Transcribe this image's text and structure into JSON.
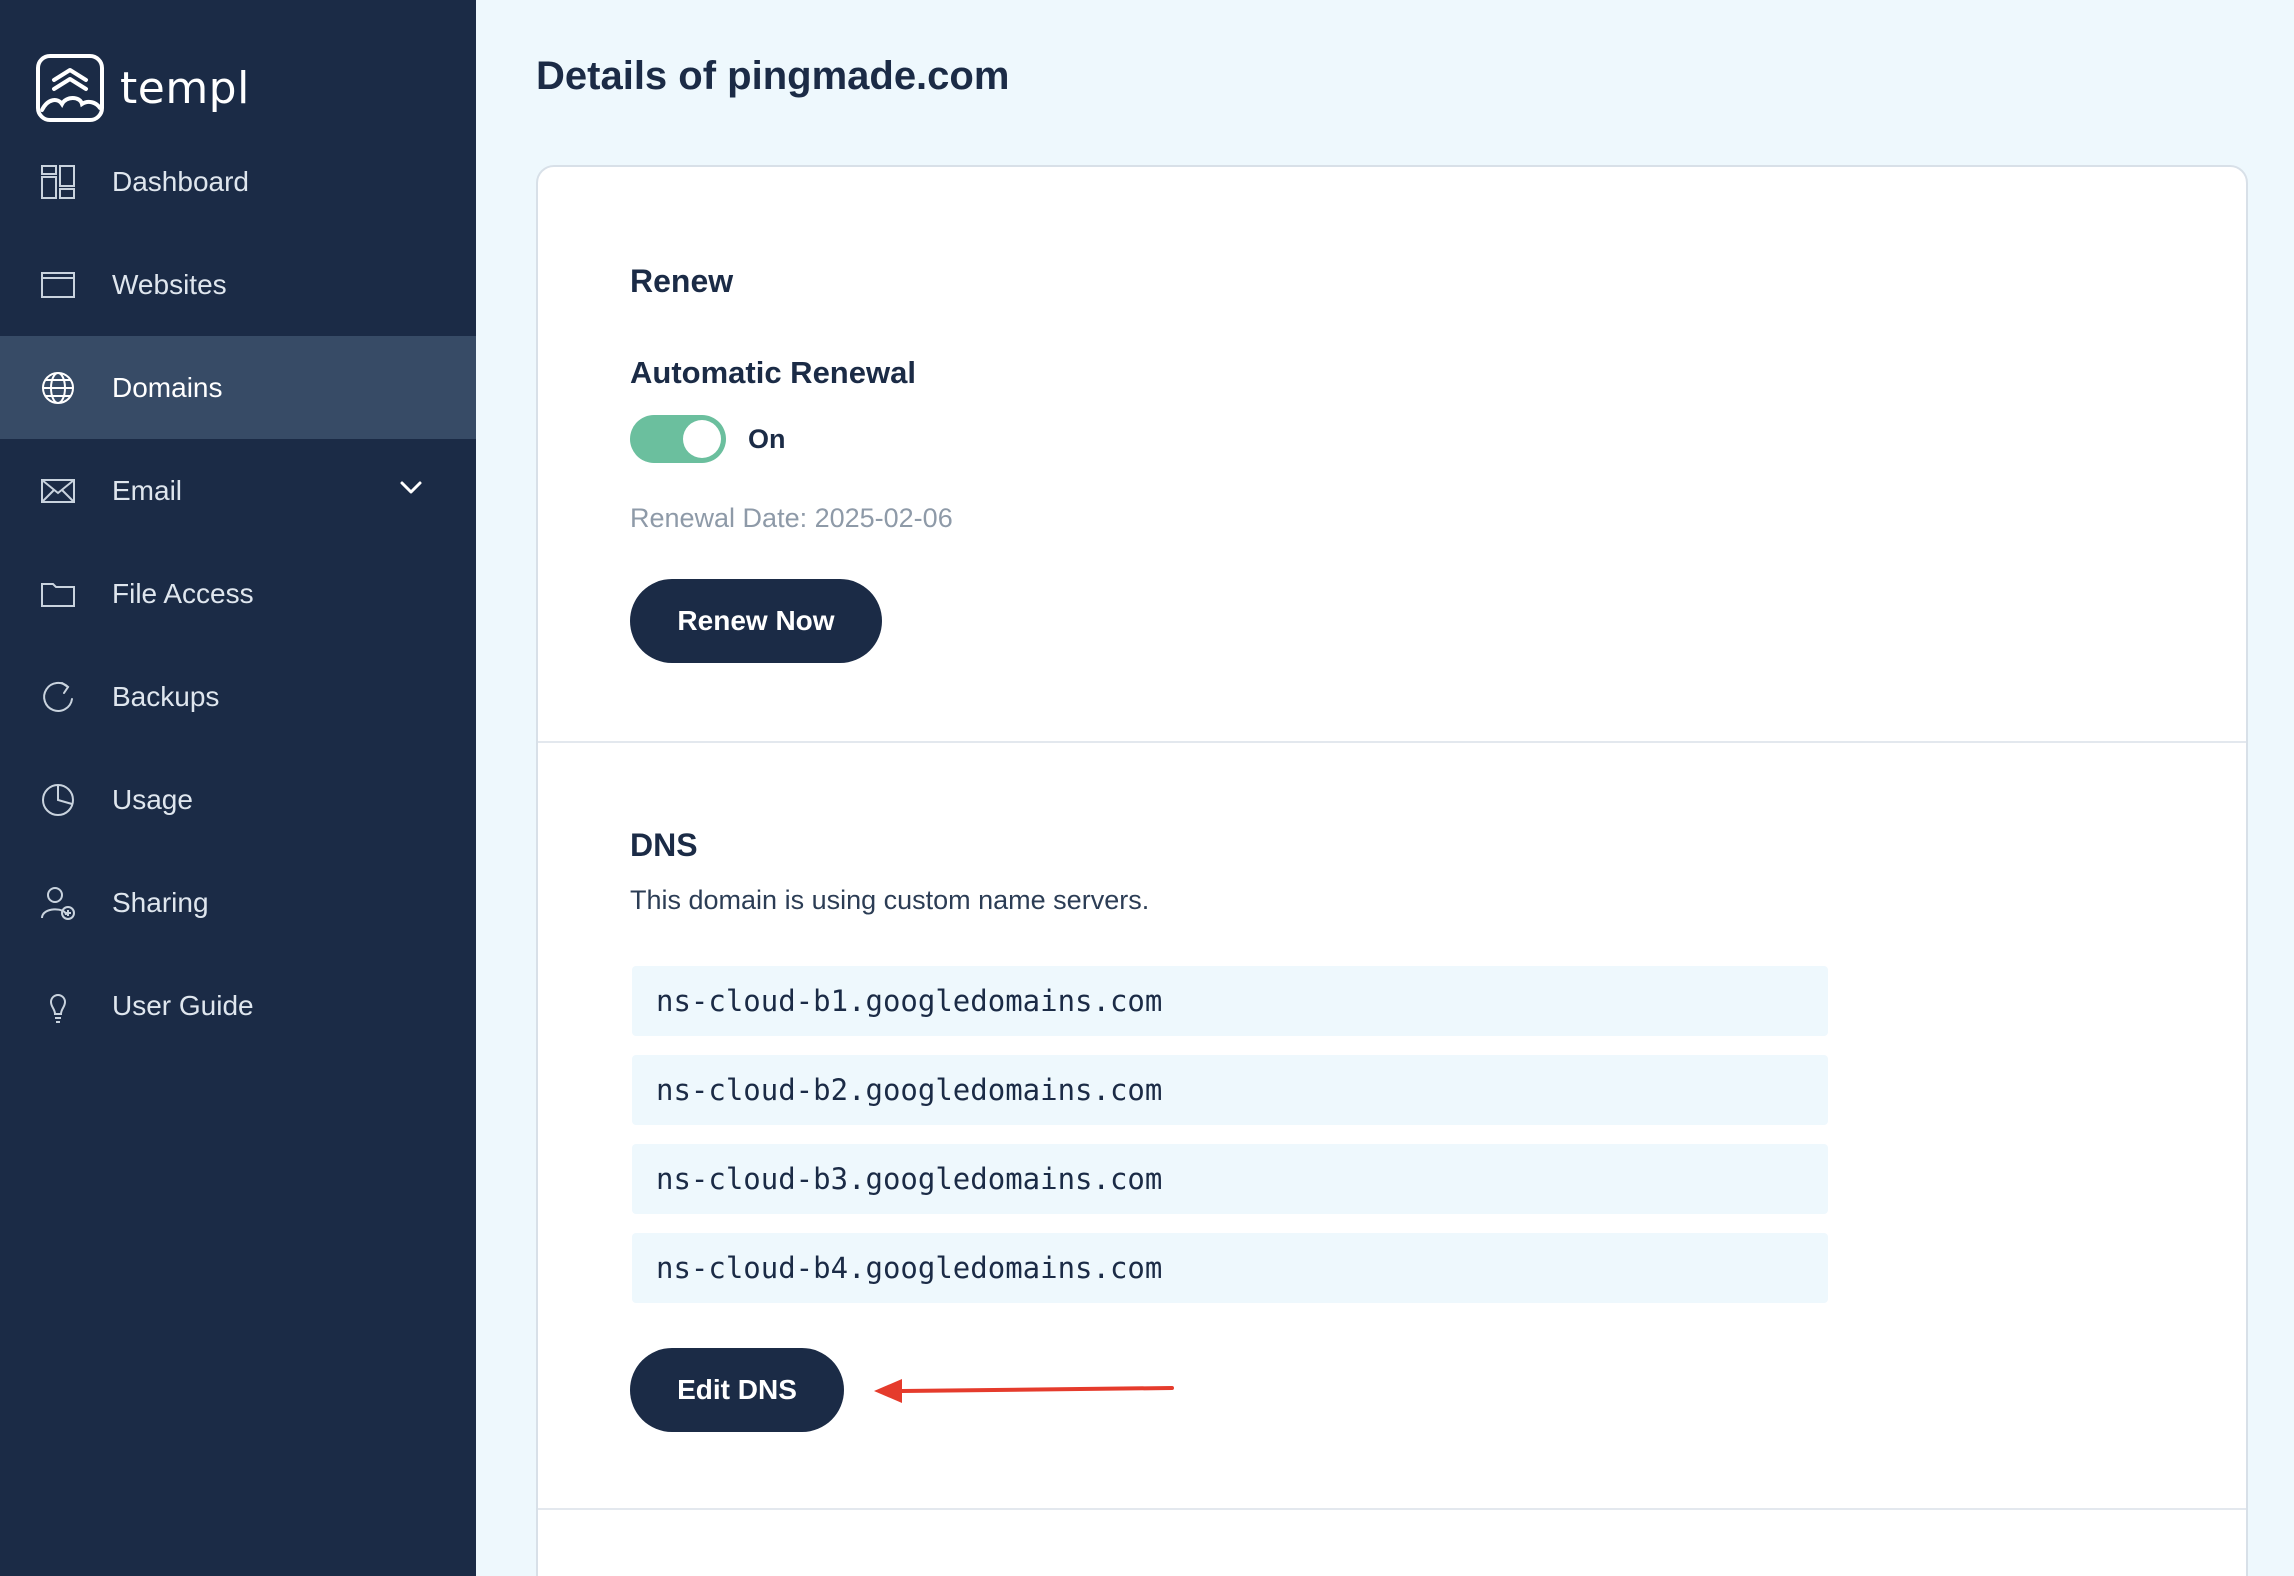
{
  "brand": {
    "name": "templ"
  },
  "sidebar": {
    "items": [
      {
        "label": "Dashboard",
        "icon": "dashboard-icon"
      },
      {
        "label": "Websites",
        "icon": "browser-window-icon"
      },
      {
        "label": "Domains",
        "icon": "globe-icon",
        "active": true
      },
      {
        "label": "Email",
        "icon": "envelope-icon",
        "has_submenu": true
      },
      {
        "label": "File Access",
        "icon": "folder-icon"
      },
      {
        "label": "Backups",
        "icon": "refresh-icon"
      },
      {
        "label": "Usage",
        "icon": "pie-chart-icon"
      },
      {
        "label": "Sharing",
        "icon": "user-add-icon"
      },
      {
        "label": "User Guide",
        "icon": "lightbulb-icon"
      }
    ]
  },
  "page": {
    "title": "Details of pingmade.com"
  },
  "renew": {
    "title": "Renew",
    "auto_renewal_label": "Automatic Renewal",
    "toggle_state": "On",
    "renewal_date": "Renewal Date: 2025-02-06",
    "renew_button": "Renew Now"
  },
  "dns": {
    "title": "DNS",
    "description": "This domain is using custom name servers.",
    "nameservers": [
      "ns-cloud-b1.googledomains.com",
      "ns-cloud-b2.googledomains.com",
      "ns-cloud-b3.googledomains.com",
      "ns-cloud-b4.googledomains.com"
    ],
    "edit_button": "Edit DNS"
  },
  "colors": {
    "sidebar_bg": "#1b2b46",
    "sidebar_active": "#374b66",
    "toggle_on": "#6bbf9e",
    "annotation_arrow": "#e53b2c"
  }
}
